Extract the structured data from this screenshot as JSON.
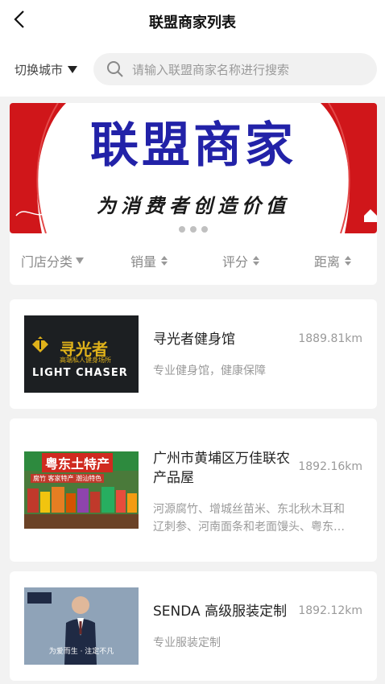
{
  "header": {
    "title": "联盟商家列表"
  },
  "search": {
    "city_label": "切换城市",
    "placeholder": "请输入联盟商家名称进行搜索"
  },
  "banner": {
    "title": "联盟商家",
    "slogan": "为消费者创造价值",
    "dots": 3
  },
  "sort": {
    "category": "门店分类",
    "sales": "销量",
    "rating": "评分",
    "distance": "距离"
  },
  "stores": [
    {
      "name": "寻光者健身馆",
      "distance": "1889.81km",
      "desc": "专业健身馆，健康保障",
      "thumb_title": "寻光者",
      "thumb_sub": "高端私人健身场所",
      "thumb_en": "LIGHT CHASER"
    },
    {
      "name_line1": "广州市黄埔区万佳联农",
      "name_line2": "产品屋",
      "distance": "1892.16km",
      "desc_line1": "河源腐竹、增城丝苗米、东北秋木耳和",
      "desc_line2": "辽刺参、河南面条和老面馒头、粤东…",
      "thumb_title": "粤东土特产",
      "thumb_tags": "腐竹  客家特产  潮汕特色"
    },
    {
      "name": "SENDA 高级服装定制",
      "distance": "1892.12km",
      "desc": "专业服装定制",
      "thumb_title": "为爱而生 · 注定不凡"
    }
  ]
}
